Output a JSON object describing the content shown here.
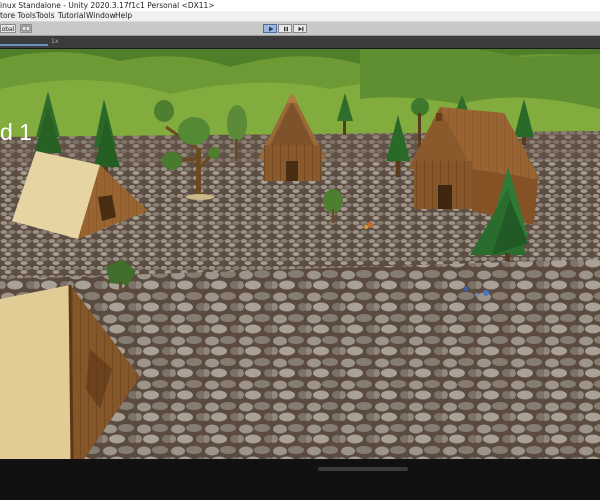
{
  "window": {
    "title": "inux Standalone - Unity 2020.3.17f1c1 Personal <DX11>"
  },
  "menu": {
    "items": [
      "tore Tools",
      "Tools",
      "Tutorial",
      "Window",
      "Help"
    ]
  },
  "toolbar": {
    "left_button_label": "obal",
    "play_selected": true
  },
  "game_view": {
    "scale_label": "1x",
    "level_title": "d 1"
  },
  "colors": {
    "accent": "#4a6fa0",
    "toolbar_bg": "#c8c8c8",
    "sky": "#5a8a2e"
  }
}
